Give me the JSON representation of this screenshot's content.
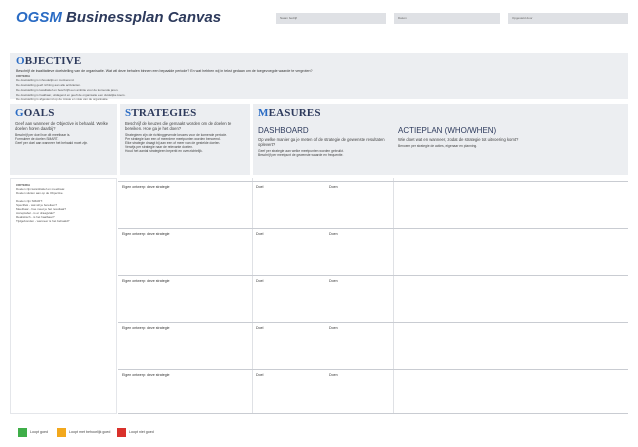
{
  "header": {
    "title_strong": "OGSM",
    "title_rest": " Businessplan Canvas",
    "meta_fields": [
      "Naam bedrijf",
      "Datum",
      "Opgesteld door"
    ]
  },
  "objective": {
    "first": "O",
    "rest": "BJECTIVE",
    "question": "Beschrijf de kwalitatieve doelstelling van de organisatie. Wat wil deze behalen binnen een bepaalde periode? En wat hebben wij in tekst gedaan om de toegevoegde waarde te vergroten?",
    "hint_label": "CRITERIA",
    "hints": [
      "De doelstelling is inhoudelijk en motiverend.",
      "De doelstelling geeft richting aan alle activiteiten.",
      "De doelstelling is kwalitatief en beschrijft een ambitie voor de komende jaren.",
      "De doelstelling is haalbaar, uitdagend en geeft de organisatie een duidelijke koers.",
      "De doelstelling is afgestemd op de missie en visie van de organisatie."
    ]
  },
  "goals": {
    "first": "G",
    "rest": "OALS",
    "subtitle": "Geef aan wanneer de Objective is behaald. Welke doelen horen daarbij?",
    "lines": [
      "Beschrijf per doel hoe dit meetbaar is.",
      "Formuleer de doelen SMART.",
      "Geef per doel aan wanneer het behaald moet zijn."
    ],
    "column": [
      "CRITERIA",
      "Doelen zijn kwantitatief en meetbaar.",
      "Doelen sluiten aan op de Objective.",
      "",
      "Doelen zijn SMART:",
      "Specifiek - wat wil je bereiken?",
      "Meetbaar - hoe meet je het resultaat?",
      "Acceptabel - is er draagvlak?",
      "Realistisch - is het haalbaar?",
      "Tijdgebonden - wanneer is het behaald?"
    ]
  },
  "strategies": {
    "first": "S",
    "rest": "TRATEGIES",
    "subtitle": "Beschrijf de keuzes die gemaakt worden om de doelen te bereiken. Hoe ga je het doen?",
    "lines": [
      "Strategieen zijn de richtinggevende keuzes voor de komende periode.",
      "Per strategie kan een of meerdere meetpunten worden benoemd.",
      "Elke strategie draagt bij aan een of meer van de gestelde doelen.",
      "Verwijs per strategie naar de relevante doelen.",
      "Houd het aantal strategieen beperkt en overzichtelijk."
    ]
  },
  "measures": {
    "first": "M",
    "rest": "EASURES",
    "dashboard_title": "DASHBOARD",
    "dashboard_sub": "Op welke manier ga je meten of de strategie de gewenste resultaten oplevert?",
    "dashboard_lines": [
      "Geef per strategie aan welke meetpunten worden gebruikt.",
      "Beschrijf per meetpunt de gewenste waarde en frequentie."
    ],
    "actieplan_title": "ACTIEPLAN (WHO/WHEN)",
    "actieplan_sub": "Wie doet wat en wanneer, zodat de strategie tot uitvoering komt?",
    "actieplan_lines": [
      "Benoem per strategie de acties, eigenaar en planning."
    ]
  },
  "rows": [
    {
      "strategy": "Eigen ontwerp: deze strategie",
      "dashboard": "Doel",
      "actie": "Doen"
    },
    {
      "strategy": "Eigen ontwerp: deze strategie",
      "dashboard": "Doel",
      "actie": "Doen"
    },
    {
      "strategy": "Eigen ontwerp: deze strategie",
      "dashboard": "Doel",
      "actie": "Doen"
    },
    {
      "strategy": "Eigen ontwerp: deze strategie",
      "dashboard": "Doel",
      "actie": "Doen"
    },
    {
      "strategy": "Eigen ontwerp: deze strategie",
      "dashboard": "Doel",
      "actie": "Doen"
    }
  ],
  "legend": [
    {
      "label": "Loopt goed",
      "color": "#3fae49"
    },
    {
      "label": "Loopt met behoorlijk goed",
      "color": "#f2a81d"
    },
    {
      "label": "Loopt niet goed",
      "color": "#d9312b"
    }
  ]
}
